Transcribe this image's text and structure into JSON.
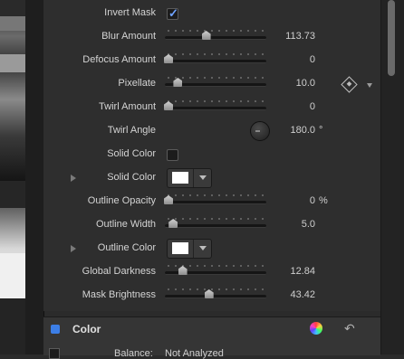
{
  "params": [
    {
      "label": "Invert Mask",
      "kind": "checkbox",
      "checked": true
    },
    {
      "label": "Blur Amount",
      "kind": "slider",
      "value": "113.73",
      "level": 0.4
    },
    {
      "label": "Defocus Amount",
      "kind": "slider",
      "value": "0",
      "level": 0
    },
    {
      "label": "Pixellate",
      "kind": "slider",
      "value": "10.0",
      "level": 0.1
    },
    {
      "label": "Twirl Amount",
      "kind": "slider",
      "value": "0",
      "level": 0
    },
    {
      "label": "Twirl Angle",
      "kind": "dial",
      "value": "180.0",
      "unit": "°"
    },
    {
      "label": "Solid Color",
      "kind": "checkbox",
      "checked": false
    },
    {
      "label": "Solid Color",
      "kind": "color",
      "color": "#ffffff",
      "disclosure": true
    },
    {
      "label": "Outline Opacity",
      "kind": "slider",
      "value": "0",
      "unit": "%",
      "level": 0
    },
    {
      "label": "Outline Width",
      "kind": "slider",
      "value": "5.0",
      "level": 0.05
    },
    {
      "label": "Outline Color",
      "kind": "color",
      "color": "#ffffff",
      "disclosure": true
    },
    {
      "label": "Global Darkness",
      "kind": "slider",
      "value": "12.84",
      "level": 0.15
    },
    {
      "label": "Mask Brightness",
      "kind": "slider",
      "value": "43.42",
      "level": 0.43
    }
  ],
  "section": {
    "title": "Color",
    "accent": "#3c7ee6",
    "balance_label": "Balance:",
    "balance_value": "Not Analyzed"
  },
  "icons": [
    "checkmark-icon",
    "disclosure-triangle-icon",
    "color-dropdown-icon",
    "keyframe-diamond-icon",
    "dropdown-arrow-icon",
    "color-wheel-icon",
    "reset-icon"
  ]
}
